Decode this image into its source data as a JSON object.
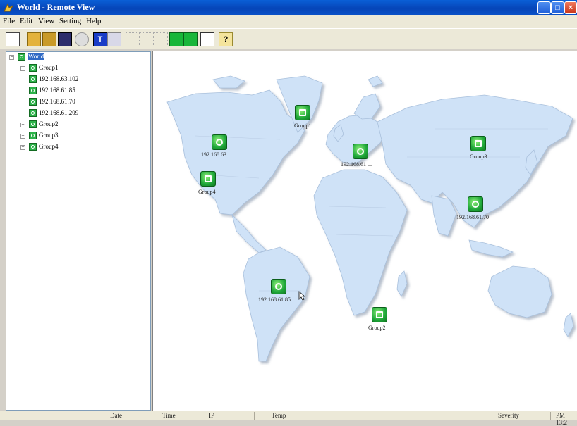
{
  "window": {
    "title": "World - Remote View"
  },
  "menu": [
    "File",
    "Edit",
    "View",
    "Setting",
    "Help"
  ],
  "toolbar": {
    "icons": [
      "new-icon",
      "open-folder-icon",
      "open-map-icon",
      "save-icon",
      "disabled-icon",
      "t-icon",
      "bar-icon",
      "cut-icon",
      "copy-icon",
      "paste-icon",
      "green-dot-icon",
      "green-dot2-icon",
      "grid-icon",
      "help-icon"
    ]
  },
  "tree": {
    "root": "World",
    "group1": "Group1",
    "children": [
      "192.168.63.102",
      "192.168.61.85",
      "192.168.61.70",
      "192.168.61.209"
    ],
    "group2": "Group2",
    "group3": "Group3",
    "group4": "Group4"
  },
  "map": {
    "markers": [
      {
        "label": "Group1",
        "type": "group"
      },
      {
        "label": "192.168.63 ...",
        "type": "device"
      },
      {
        "label": "Group4",
        "type": "group"
      },
      {
        "label": "192.168.61 ...",
        "type": "device"
      },
      {
        "label": "Group3",
        "type": "group"
      },
      {
        "label": "192.168.61.70",
        "type": "device"
      },
      {
        "label": "192.168.61.85",
        "type": "device"
      },
      {
        "label": "Group2",
        "type": "group"
      }
    ]
  },
  "status": {
    "date": "Date",
    "time": "Time",
    "ip": "IP",
    "temp": "Temp",
    "severity": "Severity",
    "clock": "PM 13:2"
  },
  "colors": {
    "titlebar": "#0645b8",
    "land": "#cfe2f7",
    "coast": "#9fb7d3",
    "marker": "#1fa83a"
  }
}
